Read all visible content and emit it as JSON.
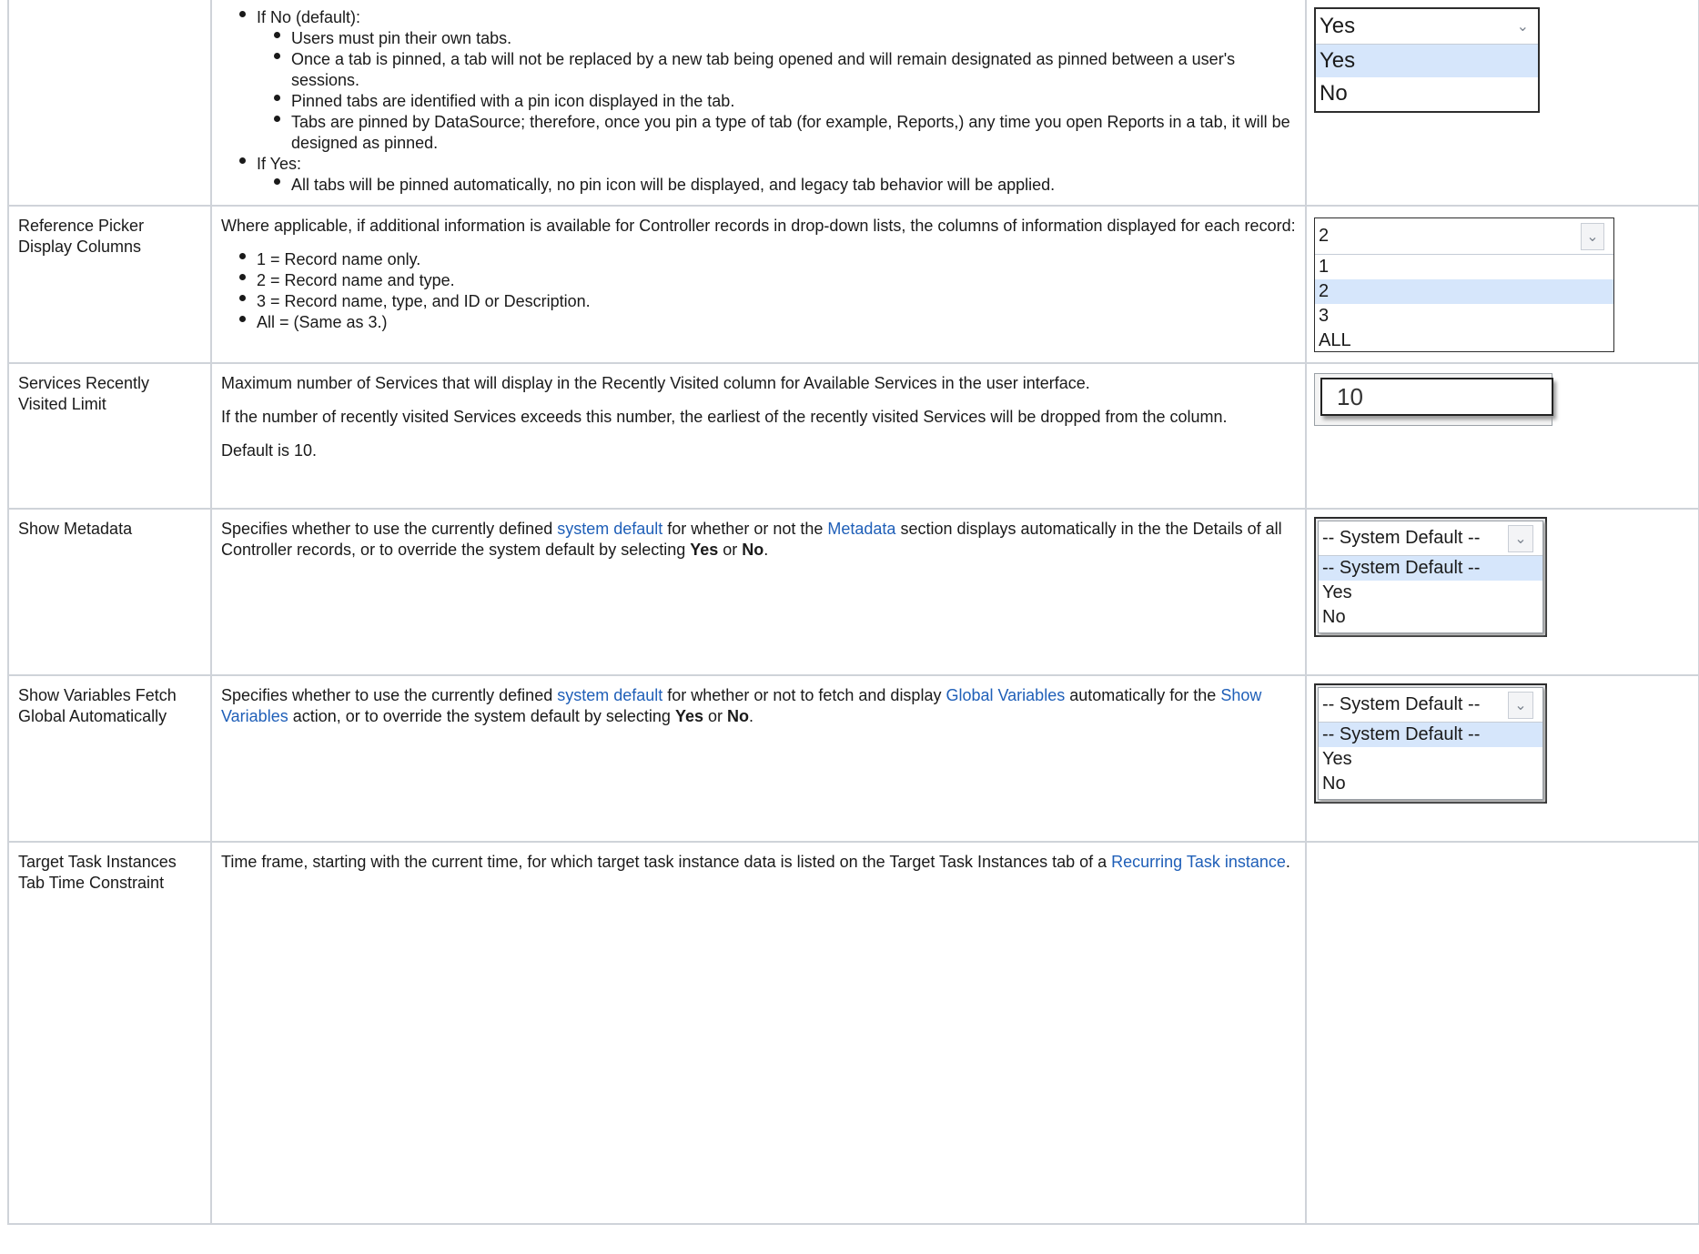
{
  "row_tabs": {
    "no_default": "If No (default):",
    "no_items": [
      "Users must pin their own tabs.",
      "Once a tab is pinned, a tab will not be replaced by a new tab being opened and will remain designated as pinned between a user's sessions.",
      "Pinned tabs are identified with a pin icon displayed in the tab.",
      "Tabs are pinned by DataSource; therefore, once you pin a type of tab (for example, Reports,) any time you open Reports in a tab, it will be designed as pinned."
    ],
    "yes_label": "If Yes:",
    "yes_items": [
      "All tabs will be pinned automatically, no pin icon will be displayed, and legacy tab behavior will be applied."
    ],
    "dropdown": {
      "selected": "Yes",
      "options": [
        "Yes",
        "No"
      ],
      "highlighted": "Yes"
    }
  },
  "row_ref_picker": {
    "name": "Reference Picker Display Columns",
    "description": "Where applicable, if additional information is available for Controller records in drop-down lists, the columns of information displayed for each record:",
    "items": [
      "1 = Record name only.",
      "2 = Record name and type.",
      "3 = Record name, type, and ID or Description.",
      "All = (Same as 3.)"
    ],
    "dropdown": {
      "selected": "2",
      "options": [
        "1",
        "2",
        "3",
        "ALL"
      ],
      "highlighted": "2"
    }
  },
  "row_services": {
    "name": "Services Recently Visited Limit",
    "p1": "Maximum number of Services that will display in the Recently Visited column for Available Services in the user interface.",
    "p2": "If the number of recently visited Services exceeds this number, the earliest of the recently visited Services will be dropped from the column.",
    "p3": "Default is 10.",
    "input_value": "10"
  },
  "row_metadata": {
    "name": "Show Metadata",
    "t1": "Specifies whether to use the currently defined ",
    "link1": "system default",
    "t2": " for whether or not the ",
    "link2": "Metadata",
    "t3": " section displays automatically in the the Details of all Controller records, or to override the system default by selecting ",
    "b1": "Yes",
    "t4": " or ",
    "b2": "No",
    "t5": ".",
    "dropdown": {
      "selected": "-- System Default --",
      "options": [
        "-- System Default --",
        "Yes",
        "No"
      ],
      "highlighted": "-- System Default --"
    }
  },
  "row_variables": {
    "name": "Show Variables Fetch Global Automatically",
    "t1": "Specifies whether to use the currently defined ",
    "link1": "system default",
    "t2": " for whether or not to fetch and display ",
    "link2": "Global Variables",
    "t3": " automatically for the ",
    "link3": "Show Variables",
    "t4": " action, or to override the system default by selecting ",
    "b1": "Yes",
    "t5": " or ",
    "b2": "No",
    "t6": ".",
    "dropdown": {
      "selected": "-- System Default --",
      "options": [
        "-- System Default --",
        "Yes",
        "No"
      ],
      "highlighted": "-- System Default --"
    }
  },
  "row_target": {
    "name": "Target Task Instances Tab Time Constraint",
    "t1": "Time frame, starting with the current time, for which target task instance data is listed on the Target Task Instances tab of a ",
    "link1": "Recurring Task instance",
    "t2": "."
  },
  "colors": {
    "link": "#1f5fb8",
    "border": "#cfd3d9",
    "highlight": "#d6e6fb"
  }
}
